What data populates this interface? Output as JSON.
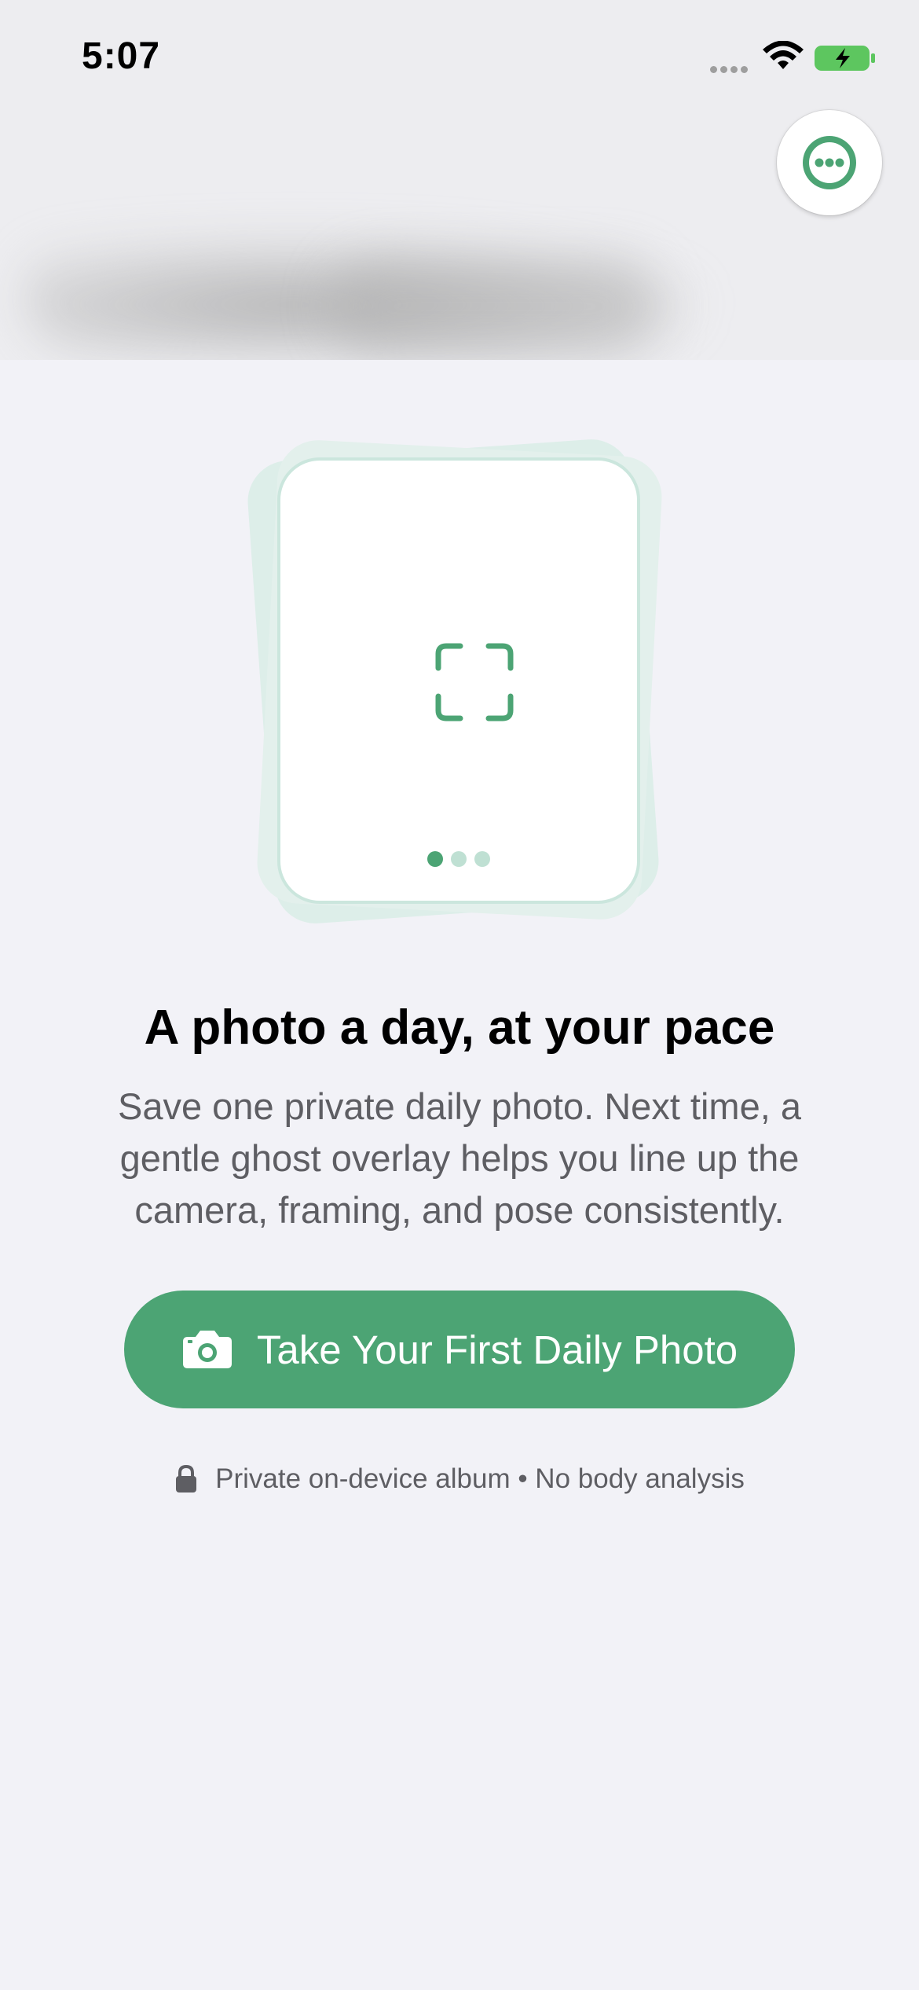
{
  "status_bar": {
    "time": "5:07",
    "signal_icon": "signal-dots-icon",
    "wifi_icon": "wifi-icon",
    "battery_icon": "battery-charging-icon",
    "battery_color": "#5DC65F"
  },
  "header": {
    "more_button_icon": "ellipsis-circle-icon"
  },
  "illustration": {
    "center_icon": "viewfinder-icon",
    "page_indicator": {
      "count": 3,
      "active_index": 0
    }
  },
  "content": {
    "headline": "A photo a day, at your pace",
    "body": "Save one private daily photo. Next time, a gentle ghost overlay helps you line up the camera, framing, and pose consistently.",
    "cta_label": "Take Your First Daily Photo",
    "cta_icon": "camera-icon",
    "privacy_note": "Private on-device album • No body analysis",
    "privacy_icon": "lock-icon"
  },
  "colors": {
    "accent": "#4CA474",
    "background": "#F2F2F7",
    "secondary_text": "#5E5E63"
  }
}
